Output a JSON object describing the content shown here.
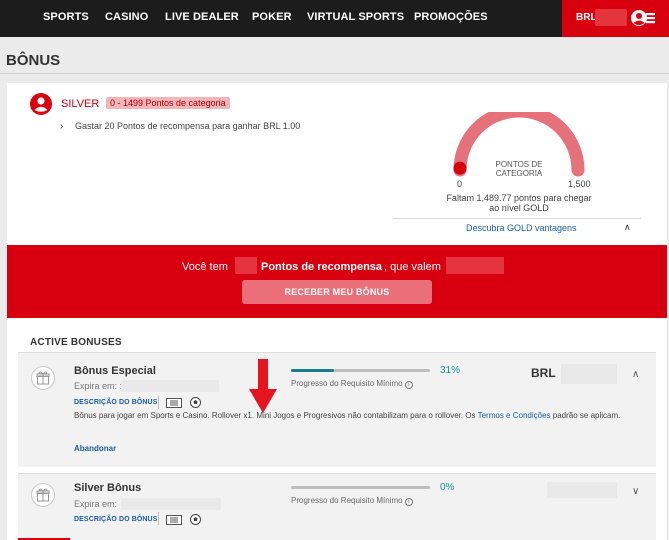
{
  "nav": {
    "items": [
      "SPORTS",
      "CASINO",
      "LIVE DEALER",
      "POKER",
      "VIRTUAL SPORTS",
      "PROMOÇÕES"
    ],
    "currency": "BRL"
  },
  "page": {
    "title": "BÔNUS"
  },
  "level": {
    "name": "SILVER",
    "range": "0 - 1499 Pontos de categoria",
    "hint": "Gastar 20 Pontos de recompensa para ganhar BRL 1.00",
    "gauge_title": "PONTOS DE CATEGORIA",
    "gauge_min": "0",
    "gauge_max": "1,500",
    "gauge_value": 0.01,
    "remaining": "Faltam 1,489.77 pontos para chegar ao nível GOLD",
    "gold_link": "Descubra GOLD vantagens"
  },
  "banner": {
    "text_pre": "Você tem",
    "text_bold": "Pontos de recompensa",
    "text_post": ", que valem",
    "button": "RECEBER MEU BÔNUS"
  },
  "active_bonuses": {
    "title": "ACTIVE BONUSES",
    "items": [
      {
        "name": "Bônus Especial",
        "expires": "Expira em: :",
        "desc_link": "DESCRIÇÃO DO BÔNUS",
        "progress_pct": "31%",
        "progress_value": 0.31,
        "progress_label": "Progresso do Requisito Mínimo",
        "currency": "BRL",
        "description": "Bônus para jogar em Sports e Casino. Rollover x1. Mini Jogos e Progresivos não contabilizam para o rollover. Os",
        "terms_link": "Termos e Condições",
        "description_end": "padrão se aplicam.",
        "abandon": "Abandonar"
      },
      {
        "name": "Silver Bônus",
        "expires": "Expira em:",
        "desc_link": "DESCRIÇÃO DO BÔNUS",
        "progress_pct": "0%",
        "progress_value": 0,
        "progress_label": "Progresso do Requisito Mínimo",
        "currency": ""
      }
    ]
  },
  "colors": {
    "brand_red": "#d8000f",
    "nav_bg": "#1c1c1c",
    "progress": "#1a7d8f",
    "link": "#1a5ea8"
  },
  "icons": [
    "user-menu-icon",
    "avatar-icon",
    "gift-icon",
    "ticket-icon",
    "soccer-ball-icon",
    "info-icon",
    "chevron-up-icon",
    "chevron-down-icon",
    "chevron-right-icon",
    "red-down-arrow"
  ]
}
